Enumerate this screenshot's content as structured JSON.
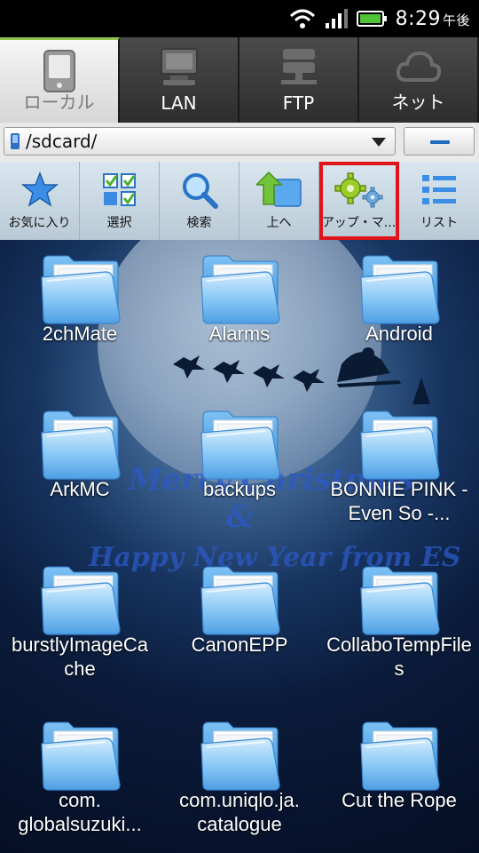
{
  "status_bar": {
    "time": "8:29",
    "ampm": "午後",
    "icons": [
      "wifi-icon",
      "signal-icon",
      "battery-icon"
    ]
  },
  "tabs": [
    {
      "label": "ローカル",
      "icon": "phone-icon",
      "active": true
    },
    {
      "label": "LAN",
      "icon": "computer-icon",
      "active": false
    },
    {
      "label": "FTP",
      "icon": "server-icon",
      "active": false
    },
    {
      "label": "ネット",
      "icon": "cloud-icon",
      "active": false
    }
  ],
  "path_bar": {
    "path": "/sdcard/",
    "icon": "sdcard-icon"
  },
  "toolbar": [
    {
      "label": "お気に入り",
      "icon": "star-icon"
    },
    {
      "label": "選択",
      "icon": "checklist-icon"
    },
    {
      "label": "検索",
      "icon": "search-icon"
    },
    {
      "label": "上へ",
      "icon": "up-folder-icon"
    },
    {
      "label": "アップ・マ...",
      "icon": "gears-icon",
      "highlighted": true
    },
    {
      "label": "リスト",
      "icon": "list-icon"
    }
  ],
  "wallpaper_text": {
    "line1": "Merry Christmas",
    "line2": "&",
    "line3": "Happy New Year from ES"
  },
  "folders": [
    {
      "name": "2chMate"
    },
    {
      "name": "Alarms"
    },
    {
      "name": "Android"
    },
    {
      "name": "ArkMC"
    },
    {
      "name": "backups"
    },
    {
      "name": "BONNIE PINK - Even So -..."
    },
    {
      "name": "burstlyImageCache"
    },
    {
      "name": "CanonEPP"
    },
    {
      "name": "CollaboTempFiles"
    },
    {
      "name": "com. globalsuzuki..."
    },
    {
      "name": "com.uniqlo.ja. catalogue"
    },
    {
      "name": "Cut the Rope"
    }
  ],
  "colors": {
    "accent_tab": "#8fc54a",
    "highlight": "#e0141a",
    "folder_blue": "#56a8ec"
  }
}
